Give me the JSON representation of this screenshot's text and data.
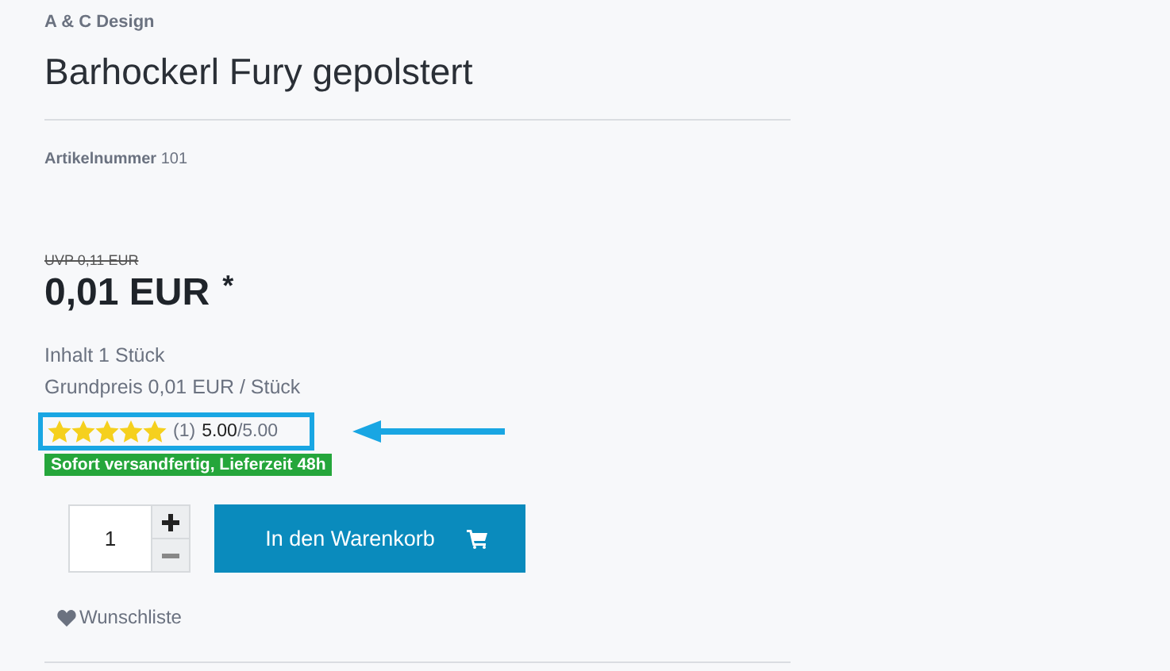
{
  "brand": "A & C Design",
  "title": "Barhockerl Fury gepolstert",
  "sku": {
    "label": "Artikelnummer",
    "value": "101"
  },
  "price": {
    "old": "UVP 0,11 EUR",
    "current": "0,01 EUR",
    "footnote": "*"
  },
  "content": "Inhalt 1 Stück",
  "base_price": "Grundpreis 0,01 EUR / Stück",
  "rating": {
    "stars": 5,
    "count": "(1)",
    "score": "5.00",
    "max": "/5.00",
    "highlighted": true
  },
  "delivery_badge": "Sofort versandfertig, Lieferzeit 48h",
  "quantity": {
    "value": "1"
  },
  "cart_button": "In den Warenkorb",
  "wishlist": "Wunschliste"
}
